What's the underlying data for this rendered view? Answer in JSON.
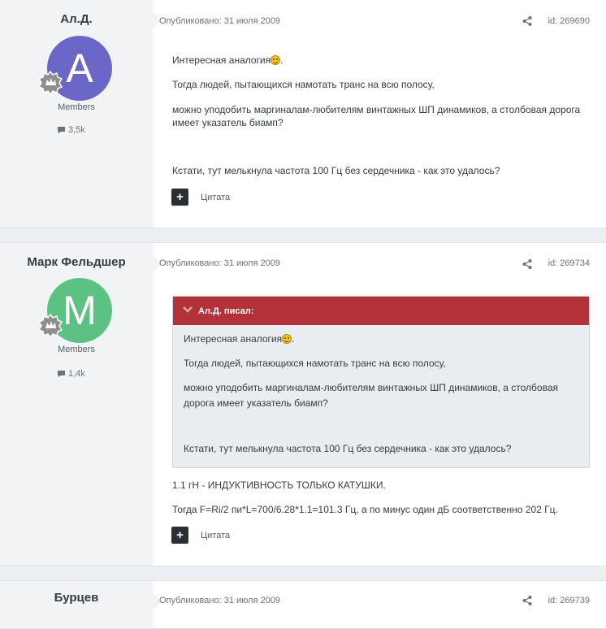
{
  "posts": [
    {
      "author": "Ал.Д.",
      "avatar_letter": "A",
      "avatar_color": "#6a67c8",
      "group": "Members",
      "post_count": "3,5k",
      "published": "Опубликовано: 31 июля 2009",
      "id": "id: 269690",
      "lines": [
        "Интересная аналогия",
        "Тогда людей, пытающихся намотать транс на всю полосу,",
        "можно уподобить маргиналам-любителям винтажных ШП динамиков, а столбовая дорога имеет указатель биамп?",
        "Кстати, тут мелькнула частота 100 Гц без сердечника - как это удалось?"
      ],
      "lines_suffix": ".",
      "quote_button": "Цитата"
    },
    {
      "author": "Марк Фельдшер",
      "avatar_letter": "M",
      "avatar_color": "#5cc283",
      "group": "Members",
      "post_count": "1,4k",
      "published": "Опубликовано: 31 июля 2009",
      "id": "id: 269734",
      "quote": {
        "title": "Ал.Д. писал:",
        "lines": [
          "Интересная аналогия",
          "Тогда людей, пытающихся намотать транс на всю полосу,",
          "можно уподобить маргиналам-любителям винтажных ШП динамиков, а столбовая дорога имеет указатель биамп?",
          "Кстати, тут мелькнула частота 100 Гц без сердечника - как это удалось?"
        ],
        "lines_suffix": "."
      },
      "lines": [
        "1.1 гН - ИНДУКТИВНОСТЬ ТОЛЬКО КАТУШКИ.",
        "Тогда F=Ri/2 пи*L=700/6.28*1.1=101.3 Гц, а по минус один дБ соответственно 202 Гц."
      ],
      "quote_button": "Цитата"
    },
    {
      "author": "Бурцев",
      "published": "Опубликовано: 31 июля 2009",
      "id": "id: 269739"
    }
  ],
  "icons": {
    "share": "share-icon",
    "comment": "comment-icon",
    "badge": "rank-badge-icon",
    "chevron": "chevron-down-icon",
    "plus": "plus-icon"
  }
}
